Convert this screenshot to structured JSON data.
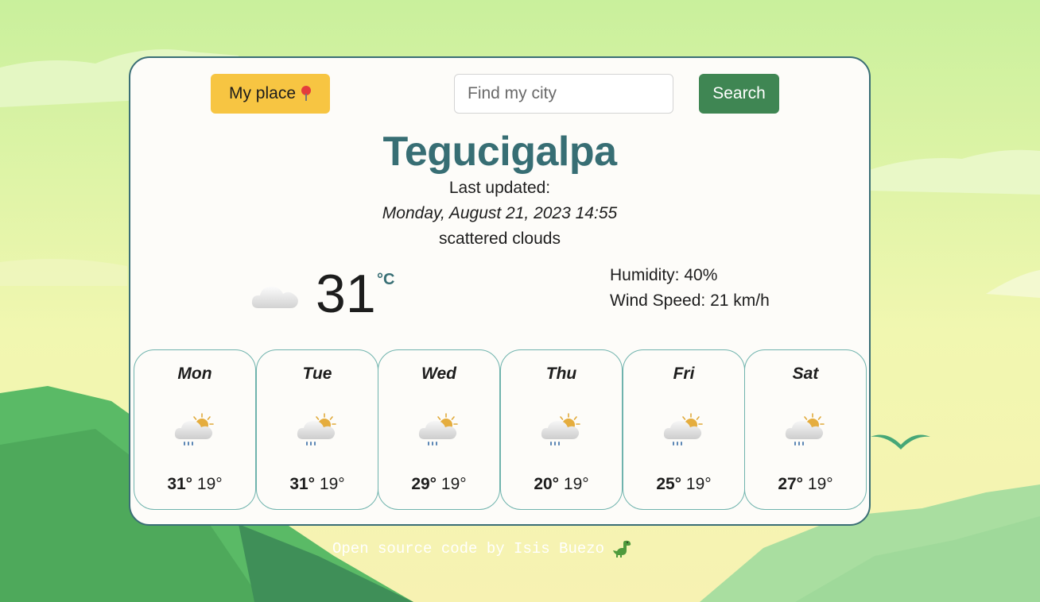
{
  "header": {
    "my_place_label": "My place",
    "search_placeholder": "Find my city",
    "search_label": "Search"
  },
  "current": {
    "city": "Tegucigalpa",
    "updated_label": "Last updated:",
    "updated_date": "Monday, August 21, 2023 14:55",
    "description": "scattered clouds",
    "temperature": "31",
    "unit": "°C",
    "humidity": "Humidity: 40%",
    "wind": "Wind Speed: 21 km/h",
    "icon": "cloud-icon"
  },
  "forecast": [
    {
      "day": "Mon",
      "max": "31°",
      "min": "19°",
      "icon": "rain-sun-icon"
    },
    {
      "day": "Tue",
      "max": "31°",
      "min": "19°",
      "icon": "rain-sun-icon"
    },
    {
      "day": "Wed",
      "max": "29°",
      "min": "19°",
      "icon": "rain-sun-icon"
    },
    {
      "day": "Thu",
      "max": "20°",
      "min": "19°",
      "icon": "rain-sun-icon"
    },
    {
      "day": "Fri",
      "max": "25°",
      "min": "19°",
      "icon": "rain-sun-icon"
    },
    {
      "day": "Sat",
      "max": "27°",
      "min": "19°",
      "icon": "rain-sun-icon"
    }
  ],
  "footer": {
    "credit": "Open source code by Isis Buezo"
  },
  "colors": {
    "accent": "#376e74",
    "place_button": "#f7c542",
    "search_button": "#3f8653",
    "card_border": "#3a6e75"
  }
}
